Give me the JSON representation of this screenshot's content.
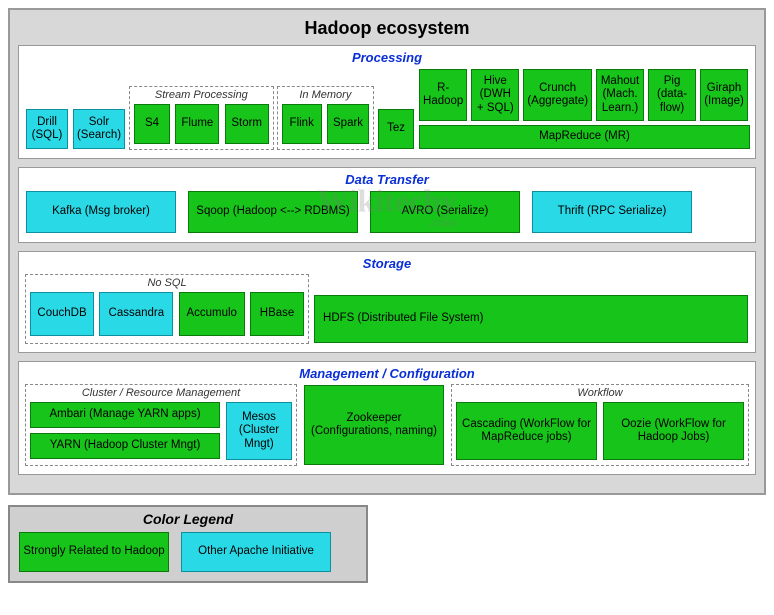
{
  "title": "Hadoop ecosystem",
  "watermark": "Wikitechy",
  "watermark_sub": ".com",
  "colors": {
    "green": "#17c41a",
    "cyan": "#2ad9e6"
  },
  "processing": {
    "title": "Processing",
    "left": {
      "drill": "Drill (SQL)",
      "solr": "Solr (Search)"
    },
    "stream": {
      "title": "Stream Processing",
      "s4": "S4",
      "flume": "Flume",
      "storm": "Storm"
    },
    "inmem": {
      "title": "In Memory",
      "flink": "Flink",
      "spark": "Spark"
    },
    "tez": "Tez",
    "right": {
      "rhadoop": "R-Hadoop",
      "hive": "Hive (DWH + SQL)",
      "crunch": "Crunch (Aggregate)",
      "mahout": "Mahout (Mach. Learn.)",
      "pig": "Pig (data-flow)",
      "giraph": "Giraph (Image)",
      "mapreduce": "MapReduce (MR)"
    }
  },
  "datatransfer": {
    "title": "Data Transfer",
    "kafka": "Kafka (Msg broker)",
    "sqoop": "Sqoop (Hadoop <--> RDBMS)",
    "avro": "AVRO (Serialize)",
    "thrift": "Thrift (RPC Serialize)"
  },
  "storage": {
    "title": "Storage",
    "nosql": {
      "title": "No SQL",
      "couchdb": "CouchDB",
      "cassandra": "Cassandra",
      "accumulo": "Accumulo",
      "hbase": "HBase"
    },
    "hdfs": "HDFS (Distributed File System)"
  },
  "mgmt": {
    "title": "Management / Configuration",
    "cluster": {
      "title": "Cluster / Resource Management",
      "ambari": "Ambari (Manage YARN apps)",
      "yarn": "YARN (Hadoop Cluster Mngt)",
      "mesos": "Mesos (Cluster Mngt)"
    },
    "zookeeper": "Zookeeper (Configurations, naming)",
    "workflow": {
      "title": "Workflow",
      "cascading": "Cascading (WorkFlow for MapReduce jobs)",
      "oozie": "Oozie (WorkFlow for Hadoop Jobs)"
    }
  },
  "legend": {
    "title": "Color Legend",
    "green": "Strongly Related to Hadoop",
    "cyan": "Other Apache Initiative"
  }
}
